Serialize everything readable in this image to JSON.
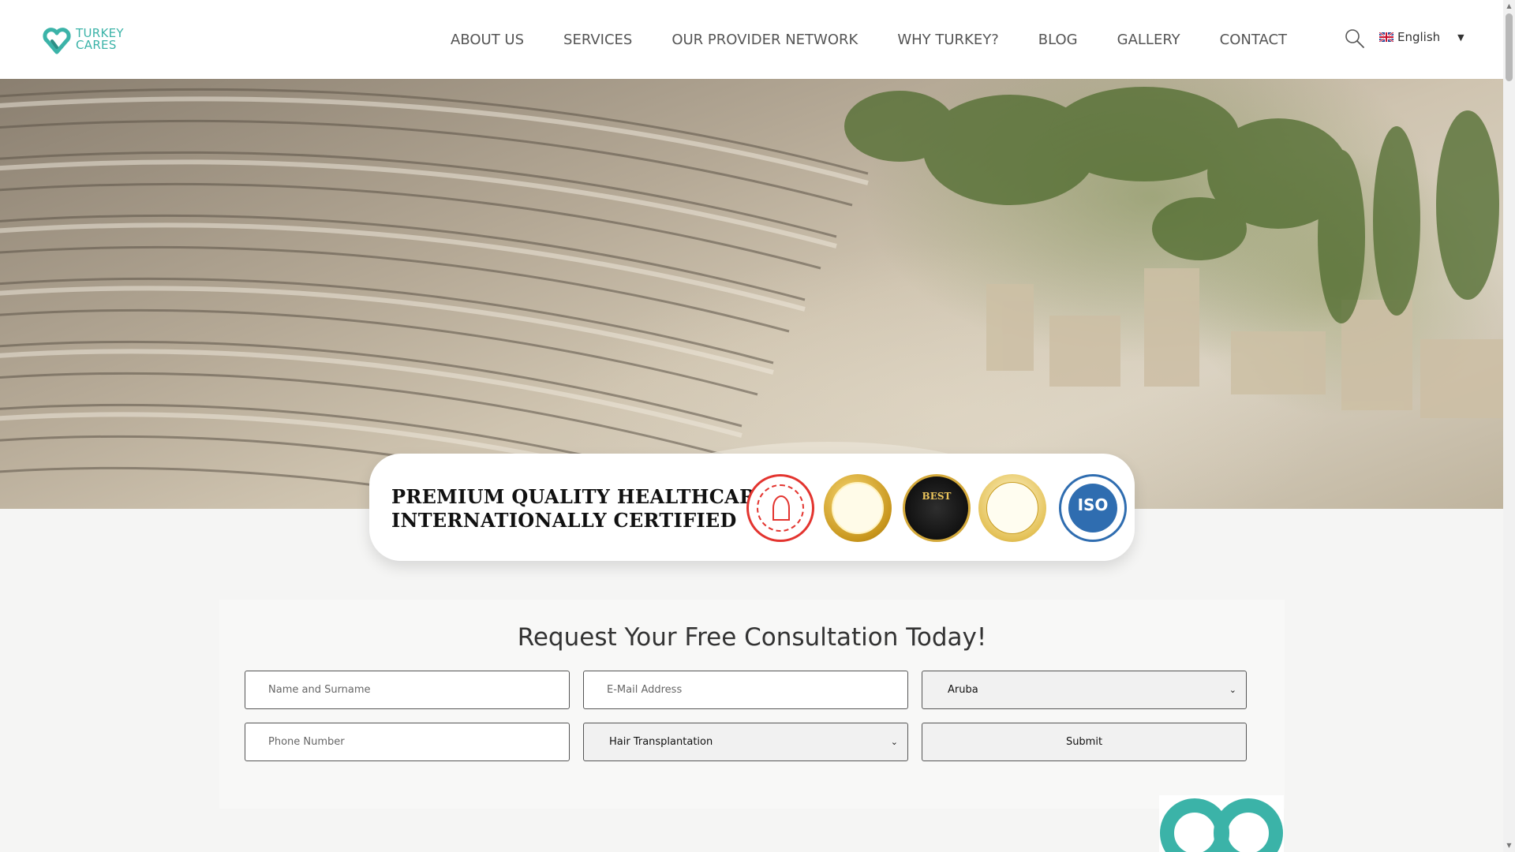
{
  "brand": {
    "line1": "TURKEY",
    "line2": "CARES",
    "color": "#3bb3a8"
  },
  "nav": {
    "items": [
      {
        "label": "ABOUT US"
      },
      {
        "label": "SERVICES"
      },
      {
        "label": "OUR PROVIDER NETWORK"
      },
      {
        "label": "WHY TURKEY?"
      },
      {
        "label": "BLOG"
      },
      {
        "label": "GALLERY"
      },
      {
        "label": "CONTACT"
      }
    ]
  },
  "header": {
    "search_icon": "search-icon",
    "language": {
      "label": "English",
      "flag_icon": "uk-flag-icon"
    }
  },
  "banner": {
    "line1": "PREMIUM QUALITY HEALTHCARE |",
    "line2": "INTERNATIONALLY CERTIFIED",
    "badges": {
      "best": "BEST",
      "iso": "ISO"
    }
  },
  "form": {
    "title": "Request Your Free Consultation Today!",
    "name_placeholder": "Name and Surname",
    "email_placeholder": "E-Mail Address",
    "country_value": "Aruba",
    "phone_placeholder": "Phone Number",
    "treatment_value": "Hair Transplantation",
    "submit_label": "Submit"
  }
}
